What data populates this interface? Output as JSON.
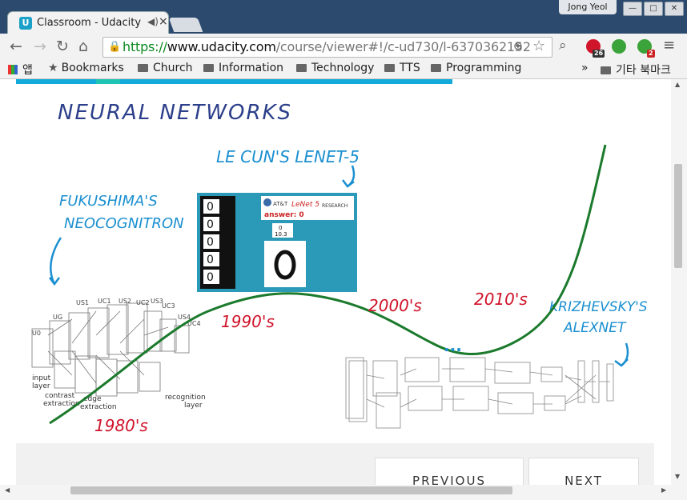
{
  "browser": {
    "tab_title": "Classroom - Udacity",
    "tab_close": "×",
    "user_name": "Jong Yeol",
    "url_scheme": "https://",
    "url_host": "www.udacity.com",
    "url_path": "/course/viewer#!/c-ud730/l-6370362152/m-",
    "ext_badges": [
      "26",
      "2"
    ]
  },
  "bookmarks": {
    "apps": "앱",
    "items": [
      "Bookmarks",
      "Church",
      "Information",
      "Technology",
      "TTS",
      "Programming"
    ],
    "overflow": "»",
    "other": "기타 북마크"
  },
  "drawing": {
    "title": "NEURAL NETWORKS",
    "lecun_label": "LE CUN'S LENET-5",
    "fukushima_label_1": "FUKUSHIMA'S",
    "fukushima_label_2": "NEOCOGNITRON",
    "krizhevsky_label_1": "KRIZHEVSKY'S",
    "krizhevsky_label_2": "ALEXNET",
    "era_1980": "1980's",
    "era_1990": "1990's",
    "era_2000": "2000's",
    "era_2010": "2010's",
    "dots": "...",
    "lenet_answer": "answer:   0",
    "lenet_logo": "LeNet 5",
    "lenet_research": "RESEARCH",
    "lenet_att": "AT&T",
    "lenet_digit": "0",
    "lenet_count": "10.3",
    "neo_input": "input",
    "neo_layer": "layer",
    "neo_contrast": "contrast",
    "neo_extraction": "extraction",
    "neo_edge": "edge",
    "neo_edge_extraction": "extraction",
    "neo_recognition": "recognition",
    "neo_recognition_layer": "layer"
  },
  "nav": {
    "previous": "PREVIOUS",
    "next": "NEXT"
  },
  "colors": {
    "blue_ink": "#2c3f8a",
    "cyan_ink": "#1a8fd0",
    "red_ink": "#d0142a",
    "green_curve": "#1b7a2c",
    "titlebar": "#2b4a6e"
  }
}
